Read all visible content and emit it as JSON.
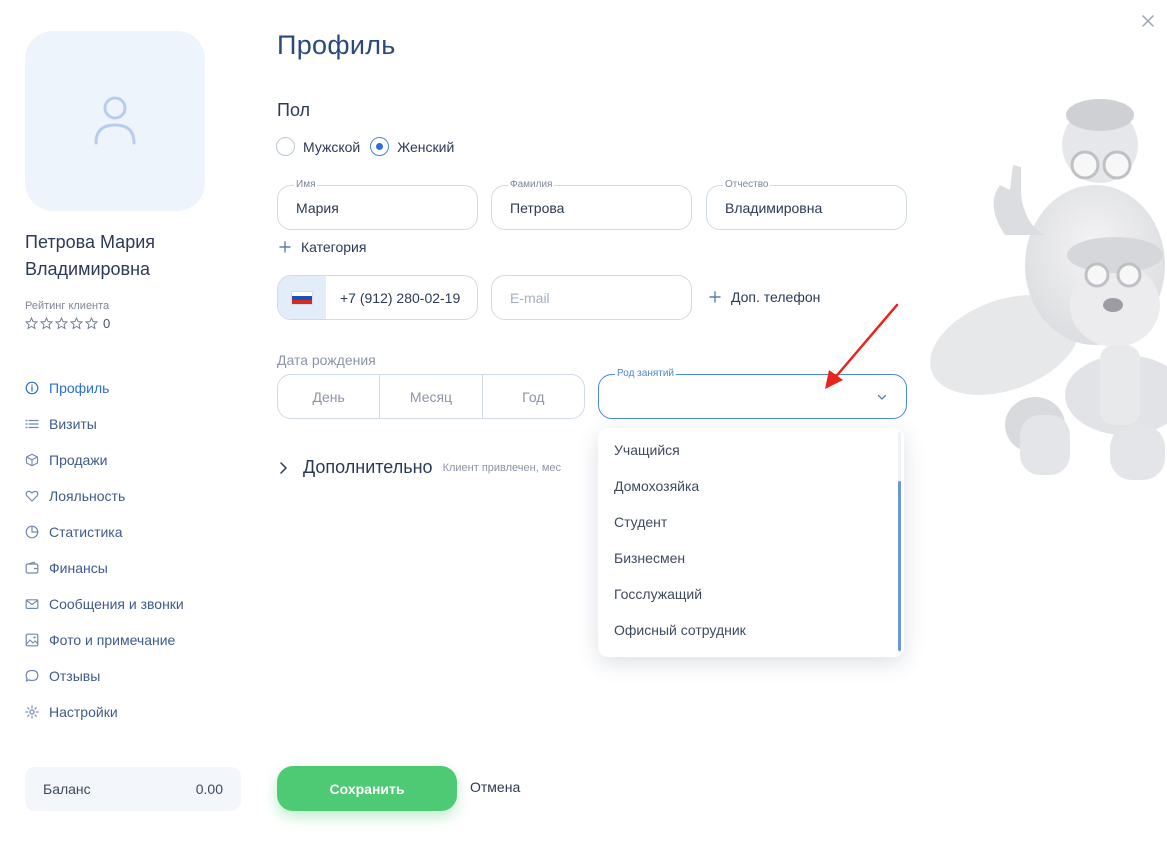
{
  "page": {
    "title": "Профиль"
  },
  "client": {
    "name_line1": "Петрова Мария",
    "name_line2": "Владимировна",
    "rating_label": "Рейтинг клиента",
    "rating_value": "0",
    "rating_stars": 0
  },
  "nav": {
    "items": [
      {
        "label": "Профиль",
        "icon": "info-icon",
        "active": true
      },
      {
        "label": "Визиты",
        "icon": "list-icon"
      },
      {
        "label": "Продажи",
        "icon": "box-icon"
      },
      {
        "label": "Лояльность",
        "icon": "heart-icon"
      },
      {
        "label": "Статистика",
        "icon": "pie-chart-icon"
      },
      {
        "label": "Финансы",
        "icon": "wallet-icon"
      },
      {
        "label": "Сообщения и звонки",
        "icon": "mail-icon"
      },
      {
        "label": "Фото и примечание",
        "icon": "image-icon"
      },
      {
        "label": "Отзывы",
        "icon": "chat-icon"
      },
      {
        "label": "Настройки",
        "icon": "gear-icon"
      }
    ]
  },
  "balance": {
    "label": "Баланс",
    "value": "0.00"
  },
  "gender": {
    "label": "Пол",
    "male": "Мужской",
    "female": "Женский",
    "selected": "female"
  },
  "fields": {
    "first_name": {
      "label": "Имя",
      "value": "Мария"
    },
    "last_name": {
      "label": "Фамилия",
      "value": "Петрова"
    },
    "patronymic": {
      "label": "Отчество",
      "value": "Владимировна"
    }
  },
  "category_link": "Категория",
  "phone": {
    "value": "+7 (912) 280-02-19"
  },
  "email": {
    "placeholder": "E-mail"
  },
  "extra_phone_link": "Доп. телефон",
  "birthdate": {
    "label": "Дата рождения",
    "day": "День",
    "month": "Месяц",
    "year": "Год"
  },
  "occupation": {
    "label": "Род занятий",
    "options": [
      "Учащийся",
      "Домохозяйка",
      "Студент",
      "Бизнесмен",
      "Госслужащий",
      "Офисный сотрудник"
    ]
  },
  "additional": {
    "title": "Дополнительно",
    "subtitle": "Клиент привлечен, мес"
  },
  "actions": {
    "save": "Сохранить",
    "cancel": "Отмена"
  },
  "colors": {
    "accent": "#2d6fd6",
    "save": "#4ec974",
    "annotation_arrow": "#e8241c"
  }
}
